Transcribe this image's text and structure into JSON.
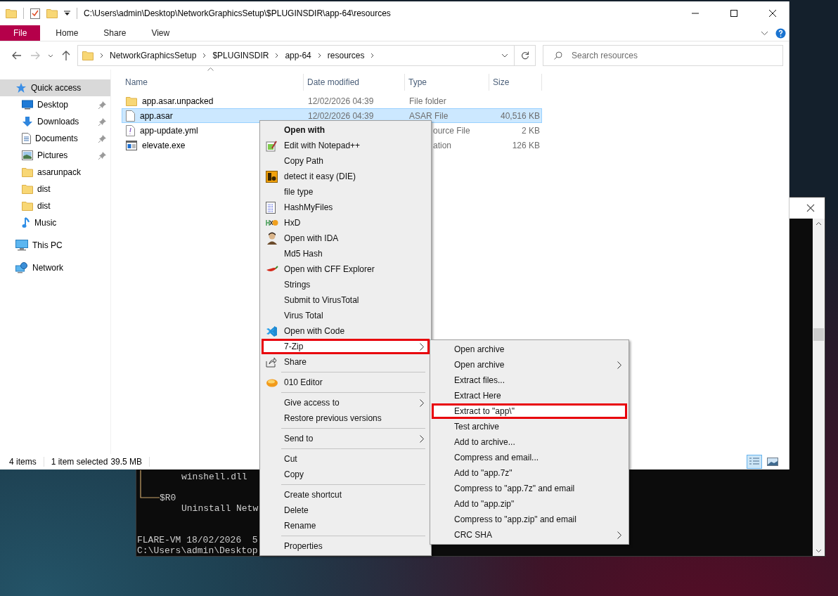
{
  "explorer": {
    "title_path": "C:\\Users\\admin\\Desktop\\NetworkGraphicsSetup\\$PLUGINSDIR\\app-64\\resources",
    "ribbon_tabs": [
      {
        "label": "File",
        "kind": "file_menu",
        "selected": false
      },
      {
        "label": "Home",
        "kind": "tab",
        "selected": false
      },
      {
        "label": "Share",
        "kind": "tab",
        "selected": false
      },
      {
        "label": "View",
        "kind": "tab",
        "selected": false
      }
    ],
    "breadcrumbs": [
      "NetworkGraphicsSetup",
      "$PLUGINSDIR",
      "app-64",
      "resources"
    ],
    "search": {
      "placeholder": "Search resources"
    },
    "nav_pane": [
      {
        "label": "Quick access",
        "selected": true,
        "children": [
          {
            "label": "Desktop",
            "pinned": true,
            "selected": false
          },
          {
            "label": "Downloads",
            "pinned": true,
            "selected": false
          },
          {
            "label": "Documents",
            "pinned": true,
            "selected": false
          },
          {
            "label": "Pictures",
            "pinned": true,
            "selected": false
          },
          {
            "label": "asarunpack",
            "pinned": false,
            "selected": false
          },
          {
            "label": "dist",
            "pinned": false,
            "selected": false
          },
          {
            "label": "dist",
            "pinned": false,
            "selected": false
          },
          {
            "label": "Music",
            "pinned": false,
            "selected": false
          }
        ]
      },
      {
        "label": "This PC",
        "selected": false
      },
      {
        "label": "Network",
        "selected": false
      }
    ],
    "columns": [
      "Name",
      "Date modified",
      "Type",
      "Size"
    ],
    "rows": [
      {
        "name": "app.asar.unpacked",
        "date_modified": "12/02/2026 04:39",
        "type": "File folder",
        "type_cut": false,
        "selected": false
      },
      {
        "name": "app.asar",
        "date_modified": "12/02/2026 04:39",
        "type": "ASAR File",
        "type_cut": false,
        "size": "40,516 KB",
        "selected": true
      },
      {
        "name": "app-update.yml",
        "type": "ource File",
        "type_cut": true,
        "size": "2 KB",
        "selected": false
      },
      {
        "name": "elevate.exe",
        "type": "ation",
        "type_cut": true,
        "size": "126 KB",
        "selected": false
      }
    ],
    "status_bar": {
      "item_count": "4 items",
      "selection": "1 item selected",
      "selection_size": "39.5 MB"
    }
  },
  "terminal": {
    "lines": [
      {
        "kind": "entry",
        "text": "winshell.dll"
      },
      {
        "kind": "blank"
      },
      {
        "kind": "branch",
        "text": "$R0"
      },
      {
        "kind": "entry",
        "text": "Uninstall Netw"
      },
      {
        "kind": "blank"
      },
      {
        "kind": "blank"
      },
      {
        "kind": "prompt",
        "text": "FLARE-VM 18/02/2026  5"
      },
      {
        "kind": "prompt",
        "text": "C:\\Users\\admin\\Desktop"
      }
    ]
  },
  "context_menu": {
    "items": [
      {
        "kind": "item",
        "label": "Open with",
        "bold": true,
        "has_icon": false,
        "submenu": false,
        "selected": false,
        "outlined": false
      },
      {
        "kind": "item",
        "label": "Edit with Notepad++",
        "bold": false,
        "has_icon": true,
        "submenu": false,
        "selected": false,
        "outlined": false
      },
      {
        "kind": "item",
        "label": "Copy Path",
        "bold": false,
        "has_icon": false,
        "submenu": false,
        "selected": false,
        "outlined": false
      },
      {
        "kind": "item",
        "label": "detect it easy (DIE)",
        "bold": false,
        "has_icon": true,
        "submenu": false,
        "selected": false,
        "outlined": false
      },
      {
        "kind": "item",
        "label": "file type",
        "bold": false,
        "has_icon": false,
        "submenu": false,
        "selected": false,
        "outlined": false
      },
      {
        "kind": "item",
        "label": "HashMyFiles",
        "bold": false,
        "has_icon": true,
        "submenu": false,
        "selected": false,
        "outlined": false
      },
      {
        "kind": "item",
        "label": "HxD",
        "bold": false,
        "has_icon": true,
        "submenu": false,
        "selected": false,
        "outlined": false
      },
      {
        "kind": "item",
        "label": "Open with IDA",
        "bold": false,
        "has_icon": true,
        "submenu": false,
        "selected": false,
        "outlined": false
      },
      {
        "kind": "item",
        "label": "Md5 Hash",
        "bold": false,
        "has_icon": false,
        "submenu": false,
        "selected": false,
        "outlined": false
      },
      {
        "kind": "item",
        "label": "Open with CFF Explorer",
        "bold": false,
        "has_icon": true,
        "submenu": false,
        "selected": false,
        "outlined": false
      },
      {
        "kind": "item",
        "label": "Strings",
        "bold": false,
        "has_icon": false,
        "submenu": false,
        "selected": false,
        "outlined": false
      },
      {
        "kind": "item",
        "label": "Submit to VirusTotal",
        "bold": false,
        "has_icon": false,
        "submenu": false,
        "selected": false,
        "outlined": false
      },
      {
        "kind": "item",
        "label": "Virus Total",
        "bold": false,
        "has_icon": false,
        "submenu": false,
        "selected": false,
        "outlined": false
      },
      {
        "kind": "item",
        "label": "Open with Code",
        "bold": false,
        "has_icon": true,
        "submenu": false,
        "selected": false,
        "outlined": false
      },
      {
        "kind": "item",
        "label": "7-Zip",
        "bold": false,
        "has_icon": false,
        "submenu": true,
        "selected": true,
        "outlined": true
      },
      {
        "kind": "item",
        "label": "Share",
        "bold": false,
        "has_icon": true,
        "submenu": false,
        "selected": false,
        "outlined": false
      },
      {
        "kind": "separator"
      },
      {
        "kind": "item",
        "label": "010 Editor",
        "bold": false,
        "has_icon": true,
        "submenu": false,
        "selected": false,
        "outlined": false
      },
      {
        "kind": "separator"
      },
      {
        "kind": "item",
        "label": "Give access to",
        "bold": false,
        "has_icon": false,
        "submenu": true,
        "selected": false,
        "outlined": false
      },
      {
        "kind": "item",
        "label": "Restore previous versions",
        "bold": false,
        "has_icon": false,
        "submenu": false,
        "selected": false,
        "outlined": false
      },
      {
        "kind": "separator"
      },
      {
        "kind": "item",
        "label": "Send to",
        "bold": false,
        "has_icon": false,
        "submenu": true,
        "selected": false,
        "outlined": false
      },
      {
        "kind": "separator"
      },
      {
        "kind": "item",
        "label": "Cut",
        "bold": false,
        "has_icon": false,
        "submenu": false,
        "selected": false,
        "outlined": false
      },
      {
        "kind": "item",
        "label": "Copy",
        "bold": false,
        "has_icon": false,
        "submenu": false,
        "selected": false,
        "outlined": false
      },
      {
        "kind": "separator"
      },
      {
        "kind": "item",
        "label": "Create shortcut",
        "bold": false,
        "has_icon": false,
        "submenu": false,
        "selected": false,
        "outlined": false
      },
      {
        "kind": "item",
        "label": "Delete",
        "bold": false,
        "has_icon": false,
        "submenu": false,
        "selected": false,
        "outlined": false
      },
      {
        "kind": "item",
        "label": "Rename",
        "bold": false,
        "has_icon": false,
        "submenu": false,
        "selected": false,
        "outlined": false
      },
      {
        "kind": "separator"
      },
      {
        "kind": "item",
        "label": "Properties",
        "bold": false,
        "has_icon": false,
        "submenu": false,
        "selected": false,
        "outlined": false
      }
    ]
  },
  "submenu": {
    "items": [
      {
        "label": "Open archive",
        "submenu": false,
        "selected": false,
        "outlined": false
      },
      {
        "label": "Open archive",
        "submenu": true,
        "selected": false,
        "outlined": false
      },
      {
        "label": "Extract files...",
        "submenu": false,
        "selected": false,
        "outlined": false
      },
      {
        "label": "Extract Here",
        "submenu": false,
        "selected": false,
        "outlined": false
      },
      {
        "label": "Extract to \"app\\\"",
        "submenu": false,
        "selected": true,
        "outlined": true
      },
      {
        "label": "Test archive",
        "submenu": false,
        "selected": false,
        "outlined": false
      },
      {
        "label": "Add to archive...",
        "submenu": false,
        "selected": false,
        "outlined": false
      },
      {
        "label": "Compress and email...",
        "submenu": false,
        "selected": false,
        "outlined": false
      },
      {
        "label": "Add to \"app.7z\"",
        "submenu": false,
        "selected": false,
        "outlined": false
      },
      {
        "label": "Compress to \"app.7z\" and email",
        "submenu": false,
        "selected": false,
        "outlined": false
      },
      {
        "label": "Add to \"app.zip\"",
        "submenu": false,
        "selected": false,
        "outlined": false
      },
      {
        "label": "Compress to \"app.zip\" and email",
        "submenu": false,
        "selected": false,
        "outlined": false
      },
      {
        "label": "CRC SHA",
        "submenu": true,
        "selected": false,
        "outlined": false
      }
    ]
  }
}
